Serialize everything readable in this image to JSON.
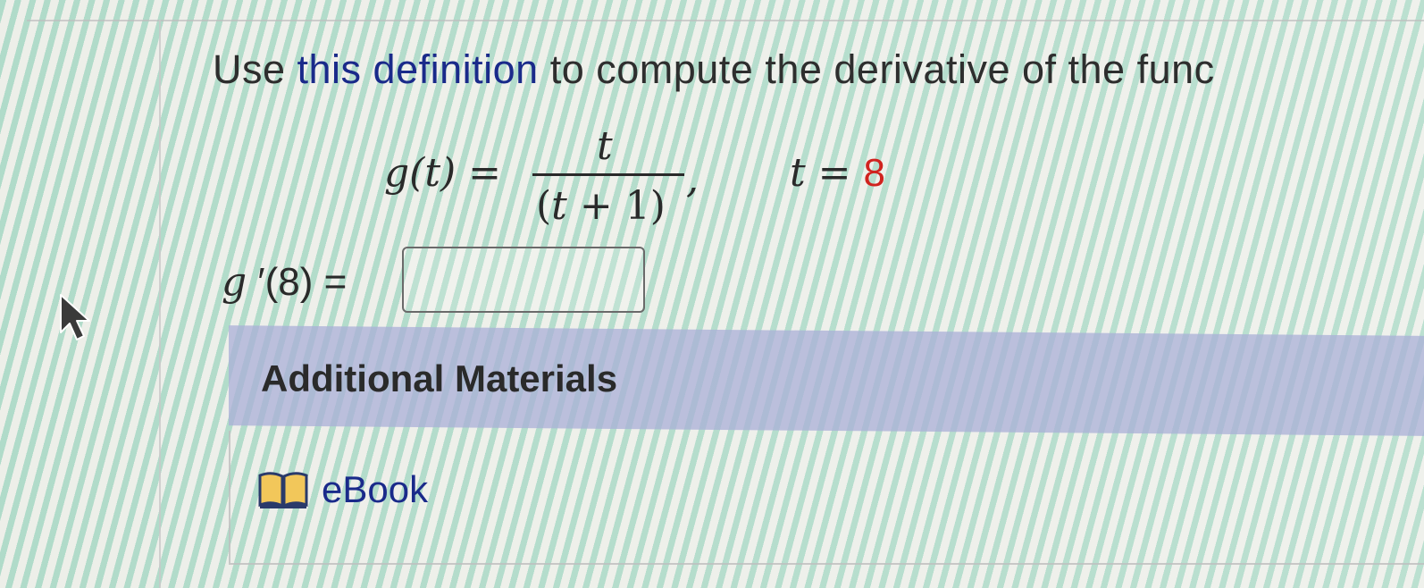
{
  "question": {
    "prompt_before_link": "Use ",
    "prompt_link": "this definition",
    "prompt_after_link": " to compute the derivative of the func"
  },
  "equation": {
    "lhs": "g(t) =",
    "numerator": "t",
    "denominator_open": "(",
    "denominator_var": "t",
    "denominator_rest": " + 1)",
    "comma": ",",
    "point_var": "t =",
    "point_value": "8"
  },
  "answer": {
    "label_func": "g",
    "label_rest": " ′(8)  =",
    "value": "",
    "placeholder": ""
  },
  "materials": {
    "title": "Additional Materials",
    "ebook_label": "eBook",
    "ebook_icon": "book-icon"
  },
  "colors": {
    "link": "#1a2a8a",
    "point_value": "#d0231f",
    "materials_bar": "#aaafd7"
  },
  "cursor_icon": "arrow-cursor-icon"
}
